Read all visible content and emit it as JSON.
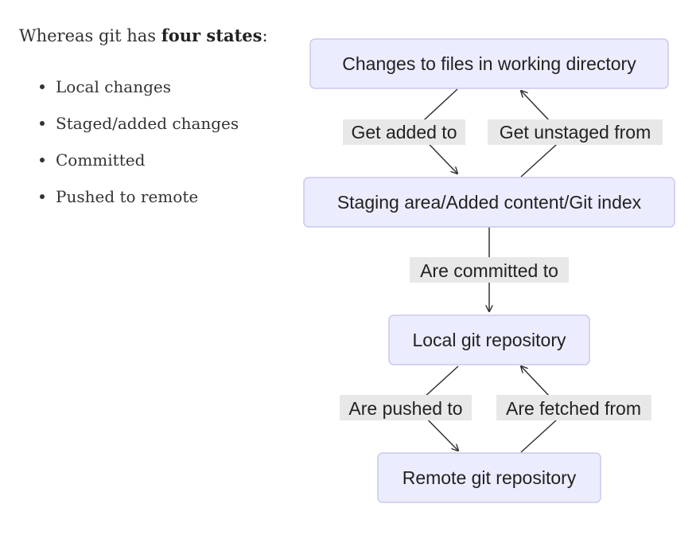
{
  "intro": {
    "prefix": "Whereas git has ",
    "emphasis": "four states",
    "suffix": ":"
  },
  "bullets": [
    "Local changes",
    "Staged/added changes",
    "Committed",
    "Pushed to remote"
  ],
  "diagram": {
    "nodes": [
      "Changes to files in working directory",
      "Staging area/Added content/Git index",
      "Local git repository",
      "Remote git repository"
    ],
    "edges": [
      "Get added to",
      "Get unstaged from",
      "Are committed to",
      "Are pushed to",
      "Are fetched from"
    ],
    "colors": {
      "node_fill": "#ececff",
      "node_border": "#c9c9ee",
      "label_background": "#e8e8e8",
      "line": "#333333"
    }
  }
}
